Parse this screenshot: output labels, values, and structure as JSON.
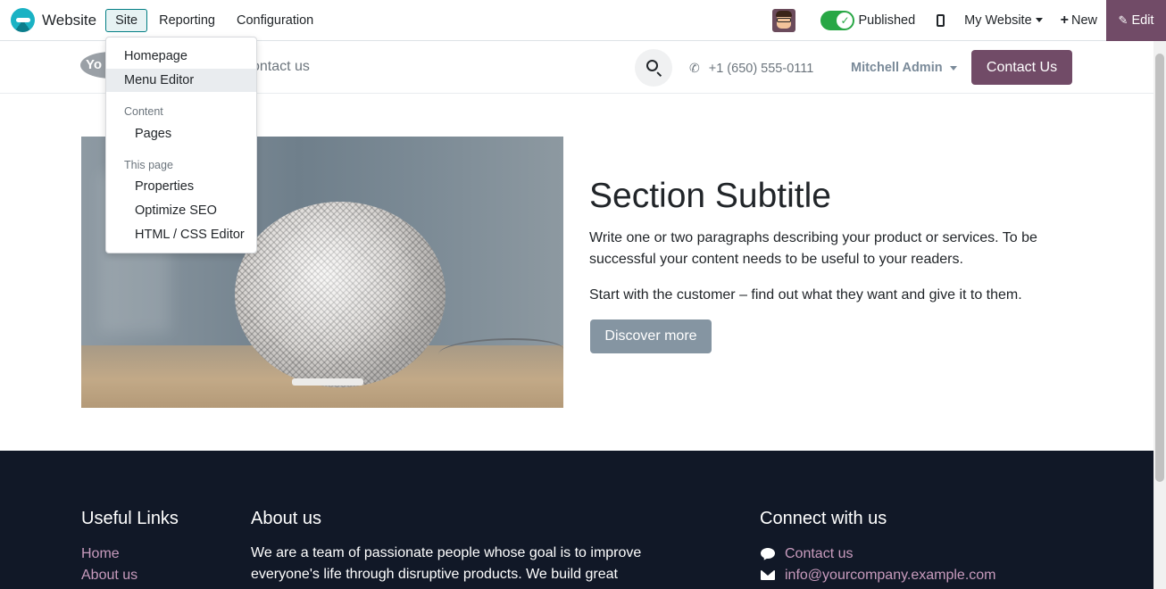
{
  "topbar": {
    "app_name": "Website",
    "menu": [
      "Site",
      "Reporting",
      "Configuration"
    ],
    "published_label": "Published",
    "published_check": "✓",
    "my_website_label": "My Website",
    "new_label": "New",
    "new_plus": "+",
    "edit_label": "Edit",
    "edit_pencil": "✎"
  },
  "site_menu": {
    "homepage": "Homepage",
    "menu_editor": "Menu Editor",
    "content_header": "Content",
    "pages": "Pages",
    "this_page_header": "This page",
    "properties": "Properties",
    "optimize_seo": "Optimize SEO",
    "html_css_editor": "HTML / CSS Editor"
  },
  "site_header": {
    "logo_text": "Yo",
    "nav_link": "ontact us",
    "phone": "+1 (650) 555-0111",
    "phone_icon": "📞",
    "user": "Mitchell Admin",
    "contact_button": "Contact Us"
  },
  "section": {
    "title": "Section Subtitle",
    "paragraph1": "Write one or two paragraphs describing your product or services. To be successful your content needs to be useful to your readers.",
    "paragraph2": "Start with the customer – find out what they want and give it to them.",
    "button": "Discover more"
  },
  "footer": {
    "useful_links_title": "Useful Links",
    "links": [
      "Home",
      "About us"
    ],
    "about_title": "About us",
    "about_text": "We are a team of passionate people whose goal is to improve everyone's life through disruptive products. We build great",
    "connect_title": "Connect with us",
    "contact_us": "Contact us",
    "email": "info@yourcompany.example.com"
  },
  "colors": {
    "brand": "#714b67",
    "published_green": "#28a745",
    "footer_bg": "#111827",
    "footer_link": "#c89bbd",
    "discover_button": "#8595a2"
  }
}
